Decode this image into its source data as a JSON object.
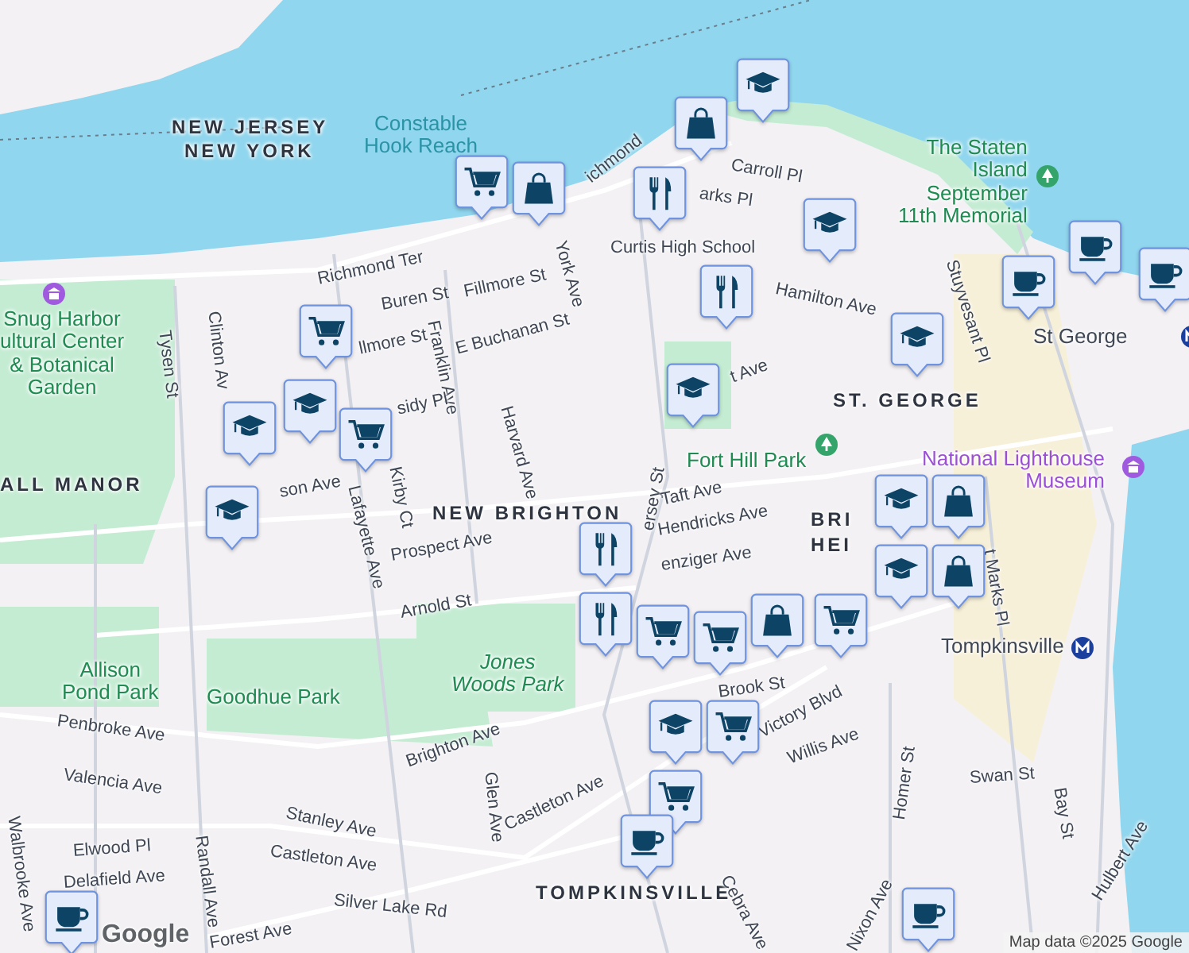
{
  "map": {
    "labels": [
      {
        "text": "NEW JERSEY",
        "kind": "district"
      },
      {
        "text": "NEW YORK",
        "kind": "district"
      },
      {
        "text": "Constable\nHook Reach",
        "kind": "water"
      },
      {
        "text": "The Staten\nIsland\nSeptember\n11th Memorial",
        "kind": "poi-green"
      },
      {
        "text": "Richmond Ter",
        "kind": "street"
      },
      {
        "text": "Snug Harbor\nultural Center\n& Botanical\nGarden",
        "kind": "poi-green"
      },
      {
        "text": "ALL MANOR",
        "kind": "district"
      },
      {
        "text": "Tysen St",
        "kind": "street"
      },
      {
        "text": "Clinton Av",
        "kind": "street"
      },
      {
        "text": "Buren St",
        "kind": "street"
      },
      {
        "text": "llmore St",
        "kind": "street"
      },
      {
        "text": "Fillmore St",
        "kind": "street"
      },
      {
        "text": "Franklin Ave",
        "kind": "street"
      },
      {
        "text": "E Buchanan St",
        "kind": "street"
      },
      {
        "text": "sidy Pl",
        "kind": "street"
      },
      {
        "text": "Kirby Ct",
        "kind": "street"
      },
      {
        "text": "Harvard Ave",
        "kind": "street"
      },
      {
        "text": "York Ave",
        "kind": "street"
      },
      {
        "text": "Lafayette Ave",
        "kind": "street"
      },
      {
        "text": "son Ave",
        "kind": "street"
      },
      {
        "text": "NEW BRIGHTON",
        "kind": "district"
      },
      {
        "text": "Prospect Ave",
        "kind": "street"
      },
      {
        "text": "Arnold St",
        "kind": "street"
      },
      {
        "text": "Allison\nPond Park",
        "kind": "park"
      },
      {
        "text": "Goodhue Park",
        "kind": "park"
      },
      {
        "text": "Jones\nWoods Park",
        "kind": "park-italic"
      },
      {
        "text": "Curtis High School",
        "kind": "street"
      },
      {
        "text": "Hamilton Ave",
        "kind": "street"
      },
      {
        "text": "Carroll Pl",
        "kind": "street"
      },
      {
        "text": "arks Pl",
        "kind": "street"
      },
      {
        "text": "ichmond",
        "kind": "street"
      },
      {
        "text": "Stuyvesant Pl",
        "kind": "street"
      },
      {
        "text": "St George",
        "kind": "transit"
      },
      {
        "text": "ST. GEORGE",
        "kind": "district"
      },
      {
        "text": "t Ave",
        "kind": "street"
      },
      {
        "text": "Fort Hill Park",
        "kind": "poi-green"
      },
      {
        "text": "National Lighthouse\nMuseum",
        "kind": "poi-purple"
      },
      {
        "text": "ersey St",
        "kind": "street"
      },
      {
        "text": "Taft Ave",
        "kind": "street"
      },
      {
        "text": "Hendricks Ave",
        "kind": "street"
      },
      {
        "text": "enziger Ave",
        "kind": "street"
      },
      {
        "text": "BRI\nHEI",
        "kind": "district"
      },
      {
        "text": "t Marks Pl",
        "kind": "street"
      },
      {
        "text": "Tompkinsville",
        "kind": "transit"
      },
      {
        "text": "Brook St",
        "kind": "street"
      },
      {
        "text": "Victory Blvd",
        "kind": "street"
      },
      {
        "text": "Willis Ave",
        "kind": "street"
      },
      {
        "text": "Penbroke Ave",
        "kind": "street"
      },
      {
        "text": "Valencia Ave",
        "kind": "street"
      },
      {
        "text": "Brighton Ave",
        "kind": "street"
      },
      {
        "text": "Glen Ave",
        "kind": "street"
      },
      {
        "text": "Stanley Ave",
        "kind": "street"
      },
      {
        "text": "Castleton Ave",
        "kind": "street"
      },
      {
        "text": "Castleton Ave",
        "kind": "street"
      },
      {
        "text": "Elwood Pl",
        "kind": "street"
      },
      {
        "text": "Delafield Ave",
        "kind": "street"
      },
      {
        "text": "Randall Ave",
        "kind": "street"
      },
      {
        "text": "Walbrooke Ave",
        "kind": "street"
      },
      {
        "text": "Silver Lake Rd",
        "kind": "street"
      },
      {
        "text": "Forest Ave",
        "kind": "street"
      },
      {
        "text": "TOMPKINSVILLE",
        "kind": "district"
      },
      {
        "text": "Cebra Ave",
        "kind": "street"
      },
      {
        "text": "Homer St",
        "kind": "street"
      },
      {
        "text": "Swan St",
        "kind": "street"
      },
      {
        "text": "Bay St",
        "kind": "street"
      },
      {
        "text": "Hulbert Ave",
        "kind": "street"
      },
      {
        "text": "Nixon Ave",
        "kind": "street"
      }
    ],
    "markers": [
      {
        "kind": "school"
      },
      {
        "kind": "shop"
      },
      {
        "kind": "grocery"
      },
      {
        "kind": "shop"
      },
      {
        "kind": "restaurant"
      },
      {
        "kind": "school"
      },
      {
        "kind": "restaurant"
      },
      {
        "kind": "cafe"
      },
      {
        "kind": "cafe"
      },
      {
        "kind": "cafe"
      },
      {
        "kind": "school"
      },
      {
        "kind": "grocery"
      },
      {
        "kind": "school"
      },
      {
        "kind": "school"
      },
      {
        "kind": "school"
      },
      {
        "kind": "grocery"
      },
      {
        "kind": "school"
      },
      {
        "kind": "school"
      },
      {
        "kind": "shop"
      },
      {
        "kind": "school"
      },
      {
        "kind": "shop"
      },
      {
        "kind": "restaurant"
      },
      {
        "kind": "restaurant"
      },
      {
        "kind": "grocery"
      },
      {
        "kind": "grocery"
      },
      {
        "kind": "shop"
      },
      {
        "kind": "grocery"
      },
      {
        "kind": "school"
      },
      {
        "kind": "grocery"
      },
      {
        "kind": "grocery"
      },
      {
        "kind": "cafe"
      },
      {
        "kind": "cafe"
      },
      {
        "kind": "cafe"
      }
    ]
  },
  "attribution": {
    "logo": "Google",
    "text": "Map data ©2025 Google"
  }
}
